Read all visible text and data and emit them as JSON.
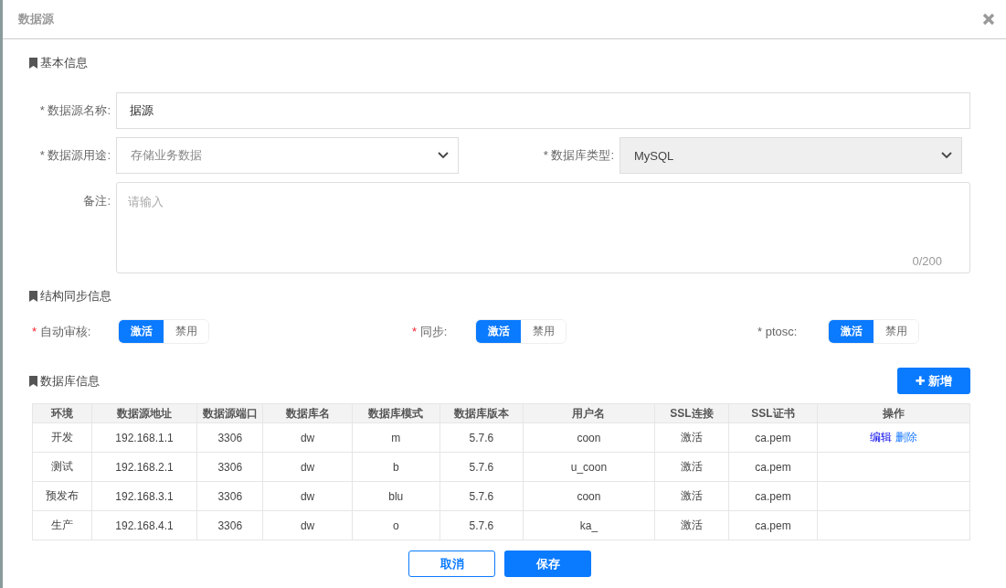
{
  "dialog": {
    "title": "数据源"
  },
  "sections": [
    {
      "title": "基本信息"
    },
    {
      "title": "结构同步信息"
    },
    {
      "title": "数据库信息"
    }
  ],
  "form": {
    "name": {
      "required_mark": "*",
      "label": "数据源名称:",
      "value": "据源"
    },
    "purpose": {
      "required_mark": "*",
      "label": "数据源用途:",
      "placeholder": "存储业务数据"
    },
    "db_type": {
      "required_mark": "*",
      "label": "数据库类型:",
      "value": "MySQL",
      "disabled": true
    },
    "remark": {
      "label": "备注:",
      "placeholder": "请输入",
      "counter": "0/200"
    }
  },
  "toggles": [
    {
      "required_mark": "*",
      "mark_highlighted": true,
      "label": "自动审核:",
      "options": [
        {
          "label": "激活",
          "selected": true
        },
        {
          "label": "禁用",
          "selected": false
        }
      ]
    },
    {
      "required_mark": "*",
      "mark_highlighted": true,
      "label": "同步:",
      "options": [
        {
          "label": "激活",
          "selected": true
        },
        {
          "label": "禁用",
          "selected": false
        }
      ]
    },
    {
      "required_mark": "*",
      "mark_highlighted": false,
      "label": "ptosc:",
      "options": [
        {
          "label": "激活",
          "selected": true
        },
        {
          "label": "禁用",
          "selected": false
        }
      ]
    }
  ],
  "add_button": {
    "icon": "✚",
    "label": "新增"
  },
  "table": {
    "columns": [
      "环境",
      "数据源地址",
      "数据源端口",
      "数据库名",
      "数据库模式",
      "数据库版本",
      "用户名",
      "SSL连接",
      "SSL证书",
      "操作"
    ],
    "rows": [
      {
        "cells": [
          "开发",
          "192.168.1.1",
          "3306",
          "dw",
          "m",
          "5.7.6",
          "coon",
          "激活",
          "ca.pem"
        ],
        "actions": [
          {
            "label": "编辑"
          },
          {
            "label": "删除"
          }
        ]
      },
      {
        "cells": [
          "测试",
          "192.168.2.1",
          "3306",
          "dw",
          "b",
          "5.7.6",
          "u_coon",
          "激活",
          "ca.pem"
        ],
        "actions": []
      },
      {
        "cells": [
          "预发布",
          "192.168.3.1",
          "3306",
          "dw",
          "blu",
          "5.7.6",
          "coon",
          "激活",
          "ca.pem"
        ],
        "actions": []
      },
      {
        "cells": [
          "生产",
          "192.168.4.1",
          "3306",
          "dw",
          "o",
          "5.7.6",
          "ka_",
          "激活",
          "ca.pem"
        ],
        "actions": []
      }
    ]
  },
  "footer": {
    "cancel": "取消",
    "save": "保存"
  }
}
